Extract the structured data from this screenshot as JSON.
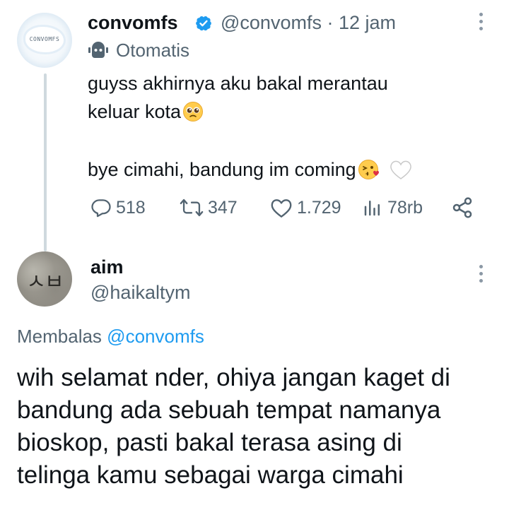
{
  "tweet": {
    "display_name": "convomfs",
    "avatar_text": "CONVOMFS",
    "handle": "@convomfs",
    "separator": "·",
    "time": "12 jam",
    "handle_time": "@convomfs · 12 jam",
    "automated_label": "Otomatis",
    "text_lines": [
      "guyss akhirnya aku bakal merantau",
      "keluar kota",
      "",
      "bye cimahi, bandung im coming"
    ],
    "stats": {
      "replies": "518",
      "retweets": "347",
      "likes": "1.729",
      "views": "78rb"
    }
  },
  "reply": {
    "display_name": "aim",
    "handle": "@haikaltym",
    "avatar_text": "ㅅㅂ",
    "replying_prefix": "Membalas",
    "replying_to": "@convomfs",
    "text_lines": [
      "wih selamat nder, ohiya jangan kaget di",
      "bandung ada sebuah tempat namanya",
      "bioskop, pasti bakal terasa asing di",
      "telinga kamu sebagai warga cimahi"
    ]
  },
  "colors": {
    "text_primary": "#0f1419",
    "text_secondary": "#536471",
    "accent": "#1d9bf0",
    "thread_line": "#cfd9de"
  },
  "icons": {
    "verified": "verified-badge-icon",
    "automated": "bot-icon",
    "reply": "reply-icon",
    "retweet": "retweet-icon",
    "like": "heart-icon",
    "views": "views-bar-icon",
    "share": "share-icon",
    "more": "more-vertical-icon"
  }
}
